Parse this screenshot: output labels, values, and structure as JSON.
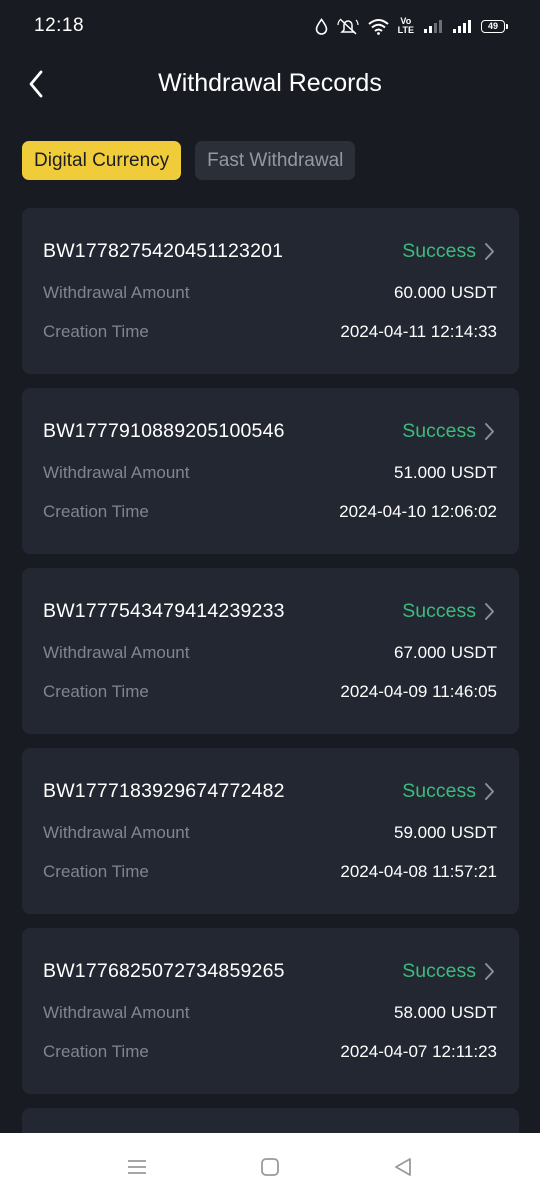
{
  "status_bar": {
    "time": "12:18",
    "volte_top": "Vo",
    "volte_bottom": "LTE",
    "battery": "49",
    "icons": [
      "water-drop-icon",
      "mute-icon",
      "wifi-icon",
      "volte-icon",
      "signal-icon",
      "signal-icon",
      "battery-icon"
    ]
  },
  "header": {
    "back_icon": "chevron-left-icon",
    "title": "Withdrawal Records"
  },
  "tabs": [
    {
      "label": "Digital Currency",
      "active": true
    },
    {
      "label": "Fast Withdrawal",
      "active": false
    }
  ],
  "labels": {
    "amount": "Withdrawal Amount",
    "time": "Creation Time"
  },
  "records": [
    {
      "id": "BW1778275420451123201",
      "status": "Success",
      "amount": "60.000 USDT",
      "time": "2024-04-11 12:14:33"
    },
    {
      "id": "BW1777910889205100546",
      "status": "Success",
      "amount": "51.000 USDT",
      "time": "2024-04-10 12:06:02"
    },
    {
      "id": "BW1777543479414239233",
      "status": "Success",
      "amount": "67.000 USDT",
      "time": "2024-04-09 11:46:05"
    },
    {
      "id": "BW1777183929674772482",
      "status": "Success",
      "amount": "59.000 USDT",
      "time": "2024-04-08 11:57:21"
    },
    {
      "id": "BW1776825072734859265",
      "status": "Success",
      "amount": "58.000 USDT",
      "time": "2024-04-07 12:11:23"
    }
  ],
  "nav_bar": {
    "icons": [
      "menu-icon",
      "home-icon",
      "back-icon"
    ]
  },
  "colors": {
    "background": "#181b22",
    "card": "#232731",
    "accent": "#f0cc3a",
    "success": "#3dbb7c",
    "muted_text": "#7f8592"
  }
}
